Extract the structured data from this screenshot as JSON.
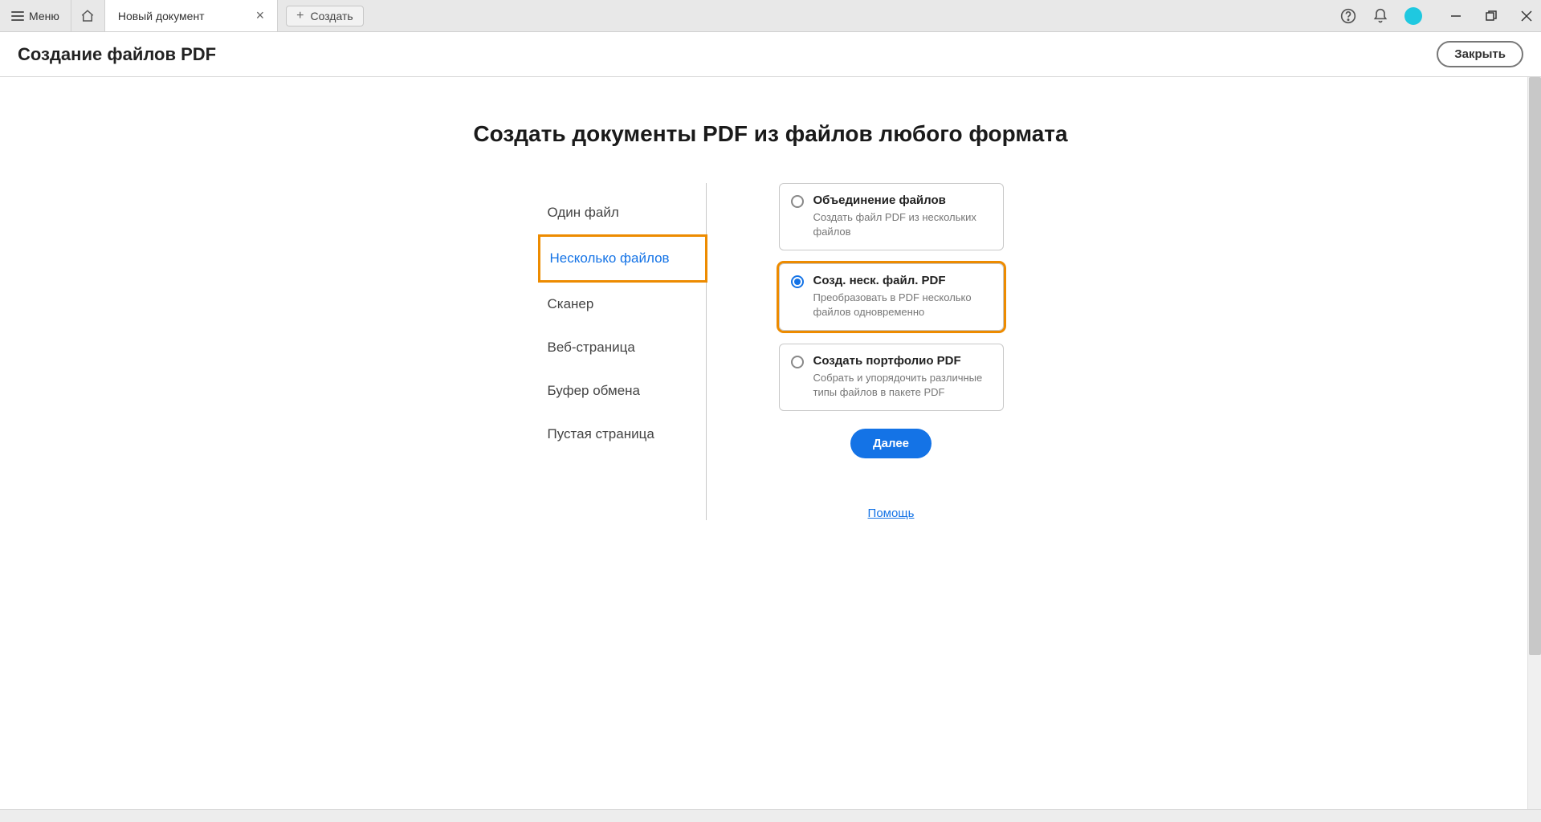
{
  "titlebar": {
    "menu_label": "Меню",
    "tab_title": "Новый документ",
    "create_label": "Создать"
  },
  "subheader": {
    "title": "Создание файлов PDF",
    "close_label": "Закрыть"
  },
  "main": {
    "heading": "Создать документы PDF из файлов любого формата",
    "categories": [
      {
        "label": "Один файл"
      },
      {
        "label": "Несколько файлов"
      },
      {
        "label": "Сканер"
      },
      {
        "label": "Веб-страница"
      },
      {
        "label": "Буфер обмена"
      },
      {
        "label": "Пустая страница"
      }
    ],
    "selected_category_index": 1,
    "options": [
      {
        "title": "Объединение файлов",
        "desc": "Создать файл PDF из нескольких файлов"
      },
      {
        "title": "Созд. неск. файл. PDF",
        "desc": "Преобразовать в PDF несколько файлов одновременно"
      },
      {
        "title": "Создать портфолио PDF",
        "desc": "Собрать и упорядочить различные типы файлов в пакете PDF"
      }
    ],
    "selected_option_index": 1,
    "next_label": "Далее",
    "help_label": "Помощь"
  }
}
